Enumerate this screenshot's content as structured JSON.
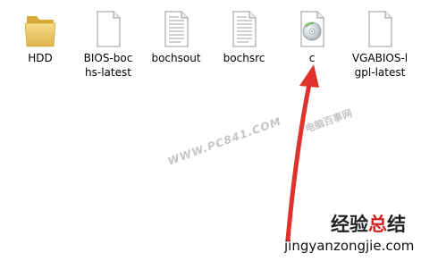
{
  "files": [
    {
      "name": "HDD",
      "icon": "folder-icon"
    },
    {
      "name": "BIOS-bochs-latest",
      "icon": "file-icon"
    },
    {
      "name": "bochsout",
      "icon": "text-file-icon"
    },
    {
      "name": "bochsrc",
      "icon": "text-file-icon"
    },
    {
      "name": "c",
      "icon": "disc-image-icon"
    },
    {
      "name": "VGABIOS-lgpl-latest",
      "icon": "file-icon"
    }
  ],
  "labels_display": [
    "HDD",
    "BIOS-boc\nhs-latest",
    "bochsout",
    "bochsrc",
    "c",
    "VGABIOS-l\ngpl-latest"
  ],
  "annotation": {
    "arrow_color": "#e0322d",
    "target": "c"
  },
  "watermarks": {
    "site_en": "WWW.PC841.COM",
    "site_cn": "电脑百事网",
    "logo_cn_part1": "经验",
    "logo_cn_part2": "总",
    "logo_cn_part3": "结",
    "logo_url": "jingyanzongjie.com"
  },
  "colors": {
    "folder": "#e8c35a",
    "logo_accent": "#d41f1f"
  }
}
